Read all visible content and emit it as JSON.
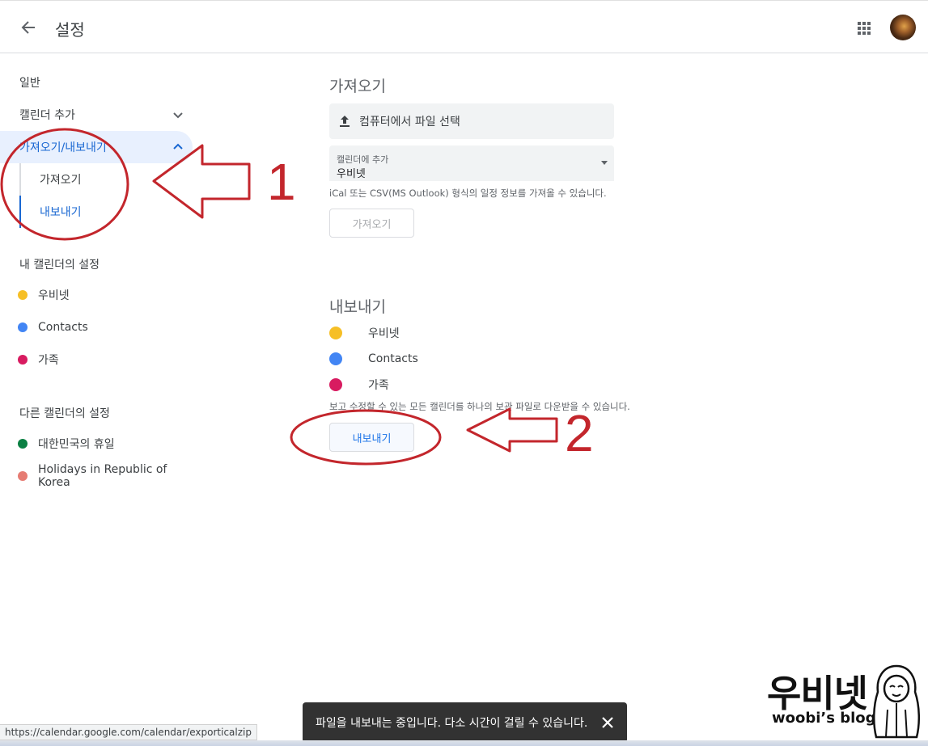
{
  "header": {
    "title": "설정",
    "back_icon": "arrow-back-icon",
    "apps_icon": "apps-grid-icon"
  },
  "sidebar": {
    "general": "일반",
    "add_calendar": "캘린더 추가",
    "import_export": "가져오기/내보내기",
    "sub_import": "가져오기",
    "sub_export": "내보내기",
    "my_calendars_heading": "내 캘린더의 설정",
    "my_calendars": [
      {
        "name": "우비넷",
        "color": "#f6bf26"
      },
      {
        "name": "Contacts",
        "color": "#4285f4"
      },
      {
        "name": "가족",
        "color": "#d81b60"
      }
    ],
    "other_calendars_heading": "다른 캘린더의 설정",
    "other_calendars": [
      {
        "name": "대한민국의 휴일",
        "color": "#0b8043"
      },
      {
        "name": "Holidays in Republic of Korea",
        "color": "#e67c73"
      }
    ]
  },
  "import": {
    "title": "가져오기",
    "file_button": "컴퓨터에서 파일 선택",
    "select_label": "캘린더에 추가",
    "select_value": "우비넷",
    "help": "iCal 또는 CSV(MS Outlook) 형식의 일정 정보를 가져올 수 있습니다.",
    "button": "가져오기"
  },
  "export": {
    "title": "내보내기",
    "calendars": [
      {
        "name": "우비넷",
        "color": "#f6bf26"
      },
      {
        "name": "Contacts",
        "color": "#4285f4"
      },
      {
        "name": "가족",
        "color": "#d81b60"
      }
    ],
    "help": "보고 수정할 수 있는 모든 캘린더를 하나의 보관 파일로 다운받을 수 있습니다.",
    "button": "내보내기"
  },
  "annotations": {
    "label_1": "1",
    "label_2": "2",
    "color": "#c3262c"
  },
  "status_url": "https://calendar.google.com/calendar/exporticalzip",
  "snackbar": {
    "message": "파일을 내보내는 중입니다. 다소 시간이 걸릴 수 있습니다."
  },
  "watermark": {
    "title": "우비넷",
    "subtitle": "woobi’s blog"
  }
}
